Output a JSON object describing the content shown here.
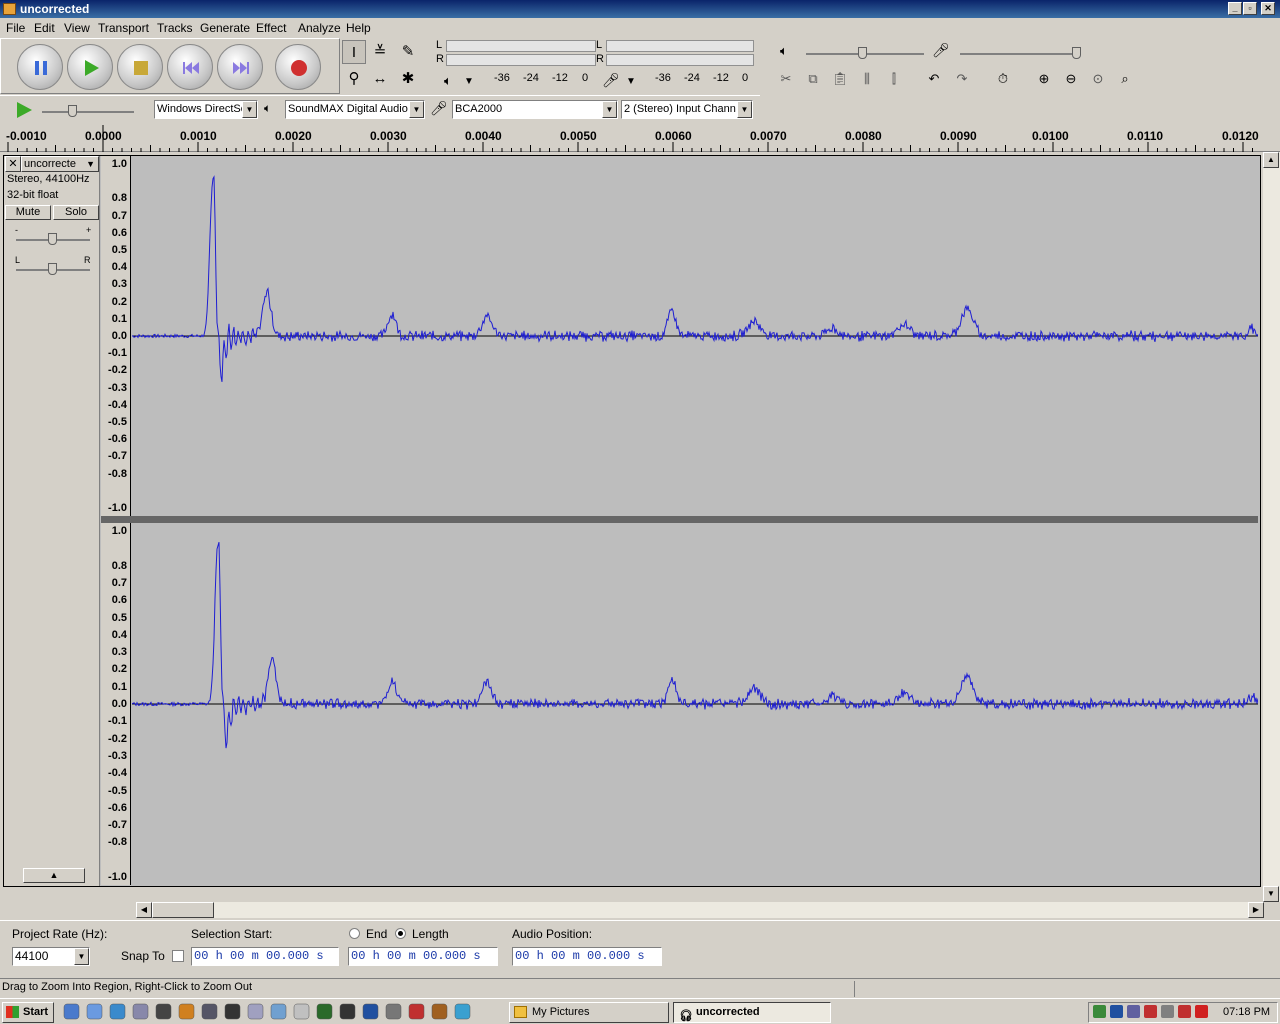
{
  "window": {
    "title": "uncorrected"
  },
  "menu": [
    "File",
    "Edit",
    "View",
    "Transport",
    "Tracks",
    "Generate",
    "Effect",
    "Analyze",
    "Help"
  ],
  "meter": {
    "L": "L",
    "R": "R",
    "ticks_play": [
      "-36",
      "-24",
      "-12",
      "0"
    ],
    "ticks_rec": [
      "-36",
      "-24",
      "-12",
      "0"
    ]
  },
  "device": {
    "host": "Windows DirectSo",
    "output": "SoundMAX Digital Audio",
    "input": "BCA2000",
    "channels": "2 (Stereo) Input Chann"
  },
  "ruler": {
    "ticks": [
      "-0.0010",
      "0.0000",
      "0.0010",
      "0.0020",
      "0.0030",
      "0.0040",
      "0.0050",
      "0.0060",
      "0.0070",
      "0.0080",
      "0.0090",
      "0.0100",
      "0.0110",
      "0.0120"
    ]
  },
  "track": {
    "name": "uncorrecte",
    "format1": "Stereo, 44100Hz",
    "format2": "32-bit float",
    "mute": "Mute",
    "solo": "Solo",
    "gain_minus": "-",
    "gain_plus": "+",
    "pan_l": "L",
    "pan_r": "R"
  },
  "scale": [
    "1.0",
    "0.8",
    "0.7",
    "0.6",
    "0.5",
    "0.4",
    "0.3",
    "0.2",
    "0.1",
    "0.0",
    "-0.1",
    "-0.2",
    "-0.3",
    "-0.4",
    "-0.5",
    "-0.6",
    "-0.7",
    "-0.8",
    "-1.0"
  ],
  "selbar": {
    "rate_label": "Project Rate (Hz):",
    "rate": "44100",
    "snap_label": "Snap To",
    "sel_start_label": "Selection Start:",
    "end_label": "End",
    "length_label": "Length",
    "audio_pos_label": "Audio Position:",
    "sel_start": "00 h 00 m 00.000 s",
    "sel_end": "00 h 00 m 00.000 s",
    "audio_pos": "00 h 00 m 00.000 s"
  },
  "status": "Drag to Zoom Into Region, Right-Click to Zoom Out",
  "taskbar": {
    "start": "Start",
    "items": [
      "My Pictures",
      "uncorrected"
    ],
    "clock": "07:18 PM"
  },
  "colors": {
    "waveform": "#1e1ed2",
    "titlebar": "#0a246a"
  }
}
